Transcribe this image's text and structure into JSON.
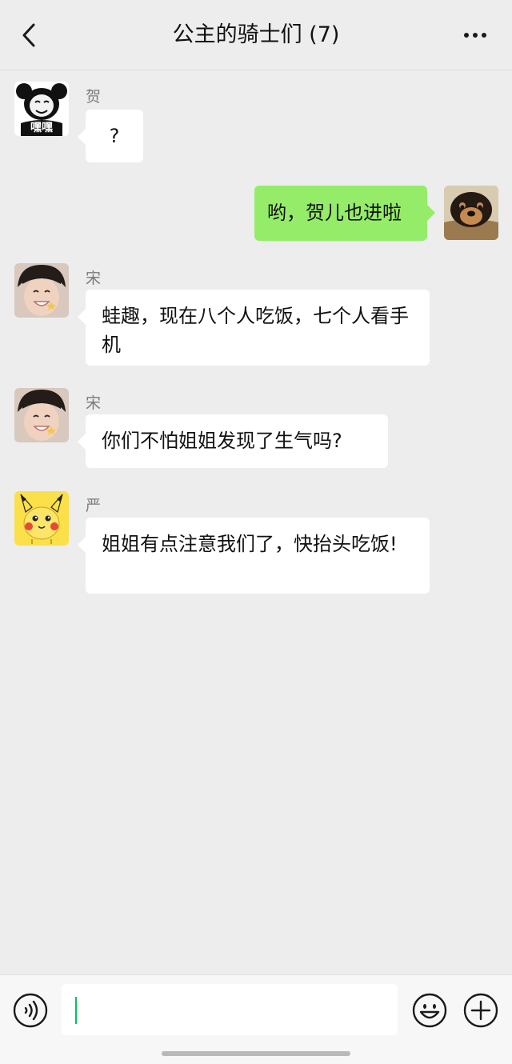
{
  "header": {
    "title": "公主的骑士们 (7)",
    "back_icon": "chevron-left-icon",
    "more_icon": "more-dots-icon"
  },
  "messages": [
    {
      "side": "left",
      "sender": "贺",
      "text": "?",
      "avatar": "panda-meme-avatar",
      "avatar_caption": "嘿嘿"
    },
    {
      "side": "right",
      "text": "哟，贺儿也进啦",
      "avatar": "dog-avatar"
    },
    {
      "side": "left",
      "sender": "宋",
      "text": "蛙趣，现在八个人吃饭，七个人看手机",
      "avatar": "boy-photo-avatar"
    },
    {
      "side": "left",
      "sender": "宋",
      "text": "你们不怕姐姐发现了生气吗?",
      "avatar": "boy-photo-avatar"
    },
    {
      "side": "left",
      "sender": "严",
      "text": "姐姐有点注意我们了，快抬头吃饭!",
      "avatar": "pikachu-avatar"
    }
  ],
  "input_bar": {
    "voice_icon": "voice-icon",
    "emoji_icon": "emoji-icon",
    "plus_icon": "plus-circle-icon",
    "value": ""
  },
  "colors": {
    "background": "#ededed",
    "bubble_self": "#95ec69",
    "bubble_other": "#ffffff",
    "caret": "#07c160"
  }
}
